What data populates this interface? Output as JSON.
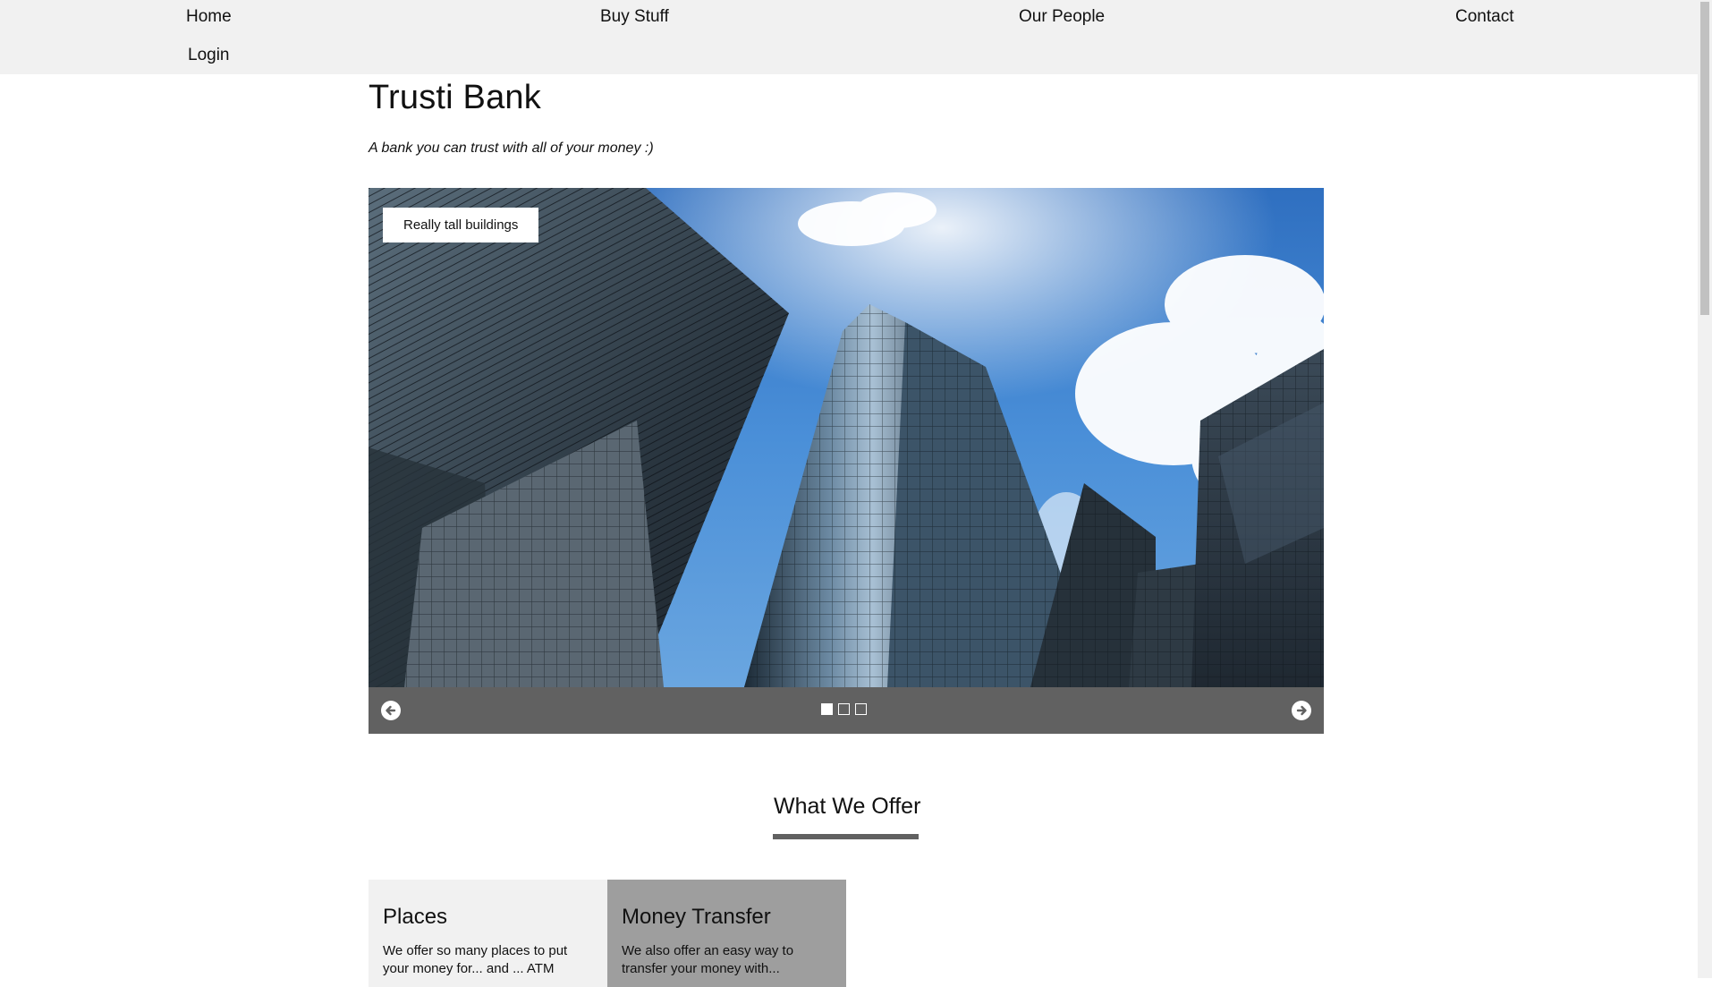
{
  "nav": {
    "items": [
      {
        "label": "Home"
      },
      {
        "label": "Buy Stuff"
      },
      {
        "label": "Our People"
      },
      {
        "label": "Contact"
      },
      {
        "label": "Login"
      }
    ]
  },
  "header": {
    "title": "Trusti Bank",
    "tagline": "A bank you can trust with all of your money :)"
  },
  "slideshow": {
    "caption": "Really tall buildings",
    "dots": [
      {
        "active": true
      },
      {
        "active": false
      },
      {
        "active": false
      }
    ],
    "prev_icon": "arrow-left-circle-icon",
    "next_icon": "arrow-right-circle-icon"
  },
  "offers": {
    "heading": "What We Offer",
    "cards": [
      {
        "title": "Places",
        "text": "We offer so many places to put your money for... and ... ATM"
      },
      {
        "title": "Money Transfer",
        "text": "We also offer an easy way to transfer your money with..."
      }
    ]
  },
  "colors": {
    "nav_bg": "#f1f1f1",
    "slide_bar": "#616161",
    "card_light": "#f1f1f1",
    "card_dark": "#9e9e9e"
  }
}
